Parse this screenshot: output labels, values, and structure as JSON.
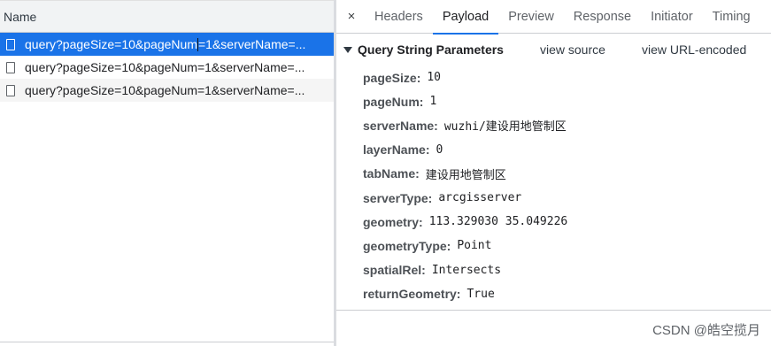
{
  "request_list": {
    "column_header": "Name",
    "rows": [
      {
        "text_before_cursor": "query?pageSize=10&pageNum",
        "text_after_cursor": "=1&serverName=...",
        "selected": true
      },
      {
        "text": "query?pageSize=10&pageNum=1&serverName=...",
        "selected": false
      },
      {
        "text": "query?pageSize=10&pageNum=1&serverName=...",
        "selected": false
      }
    ]
  },
  "details": {
    "close_icon": "×",
    "tabs": [
      "Headers",
      "Payload",
      "Preview",
      "Response",
      "Initiator",
      "Timing"
    ],
    "active_tab": "Payload",
    "section": {
      "title": "Query String Parameters",
      "view_source": "view source",
      "view_url_encoded": "view URL-encoded"
    },
    "params": [
      {
        "key": "pageSize:",
        "value": "10"
      },
      {
        "key": "pageNum:",
        "value": "1"
      },
      {
        "key": "serverName:",
        "value": "wuzhi/建设用地管制区"
      },
      {
        "key": "layerName:",
        "value": "0"
      },
      {
        "key": "tabName:",
        "value": "建设用地管制区"
      },
      {
        "key": "serverType:",
        "value": "arcgisserver"
      },
      {
        "key": "geometry:",
        "value": "113.329030 35.049226"
      },
      {
        "key": "geometryType:",
        "value": "Point"
      },
      {
        "key": "spatialRel:",
        "value": "Intersects"
      },
      {
        "key": "returnGeometry:",
        "value": "True"
      }
    ]
  },
  "watermark": "CSDN @皓空揽月",
  "colors": {
    "selection": "#1a73e8",
    "tab_indicator": "#1a73e8"
  }
}
